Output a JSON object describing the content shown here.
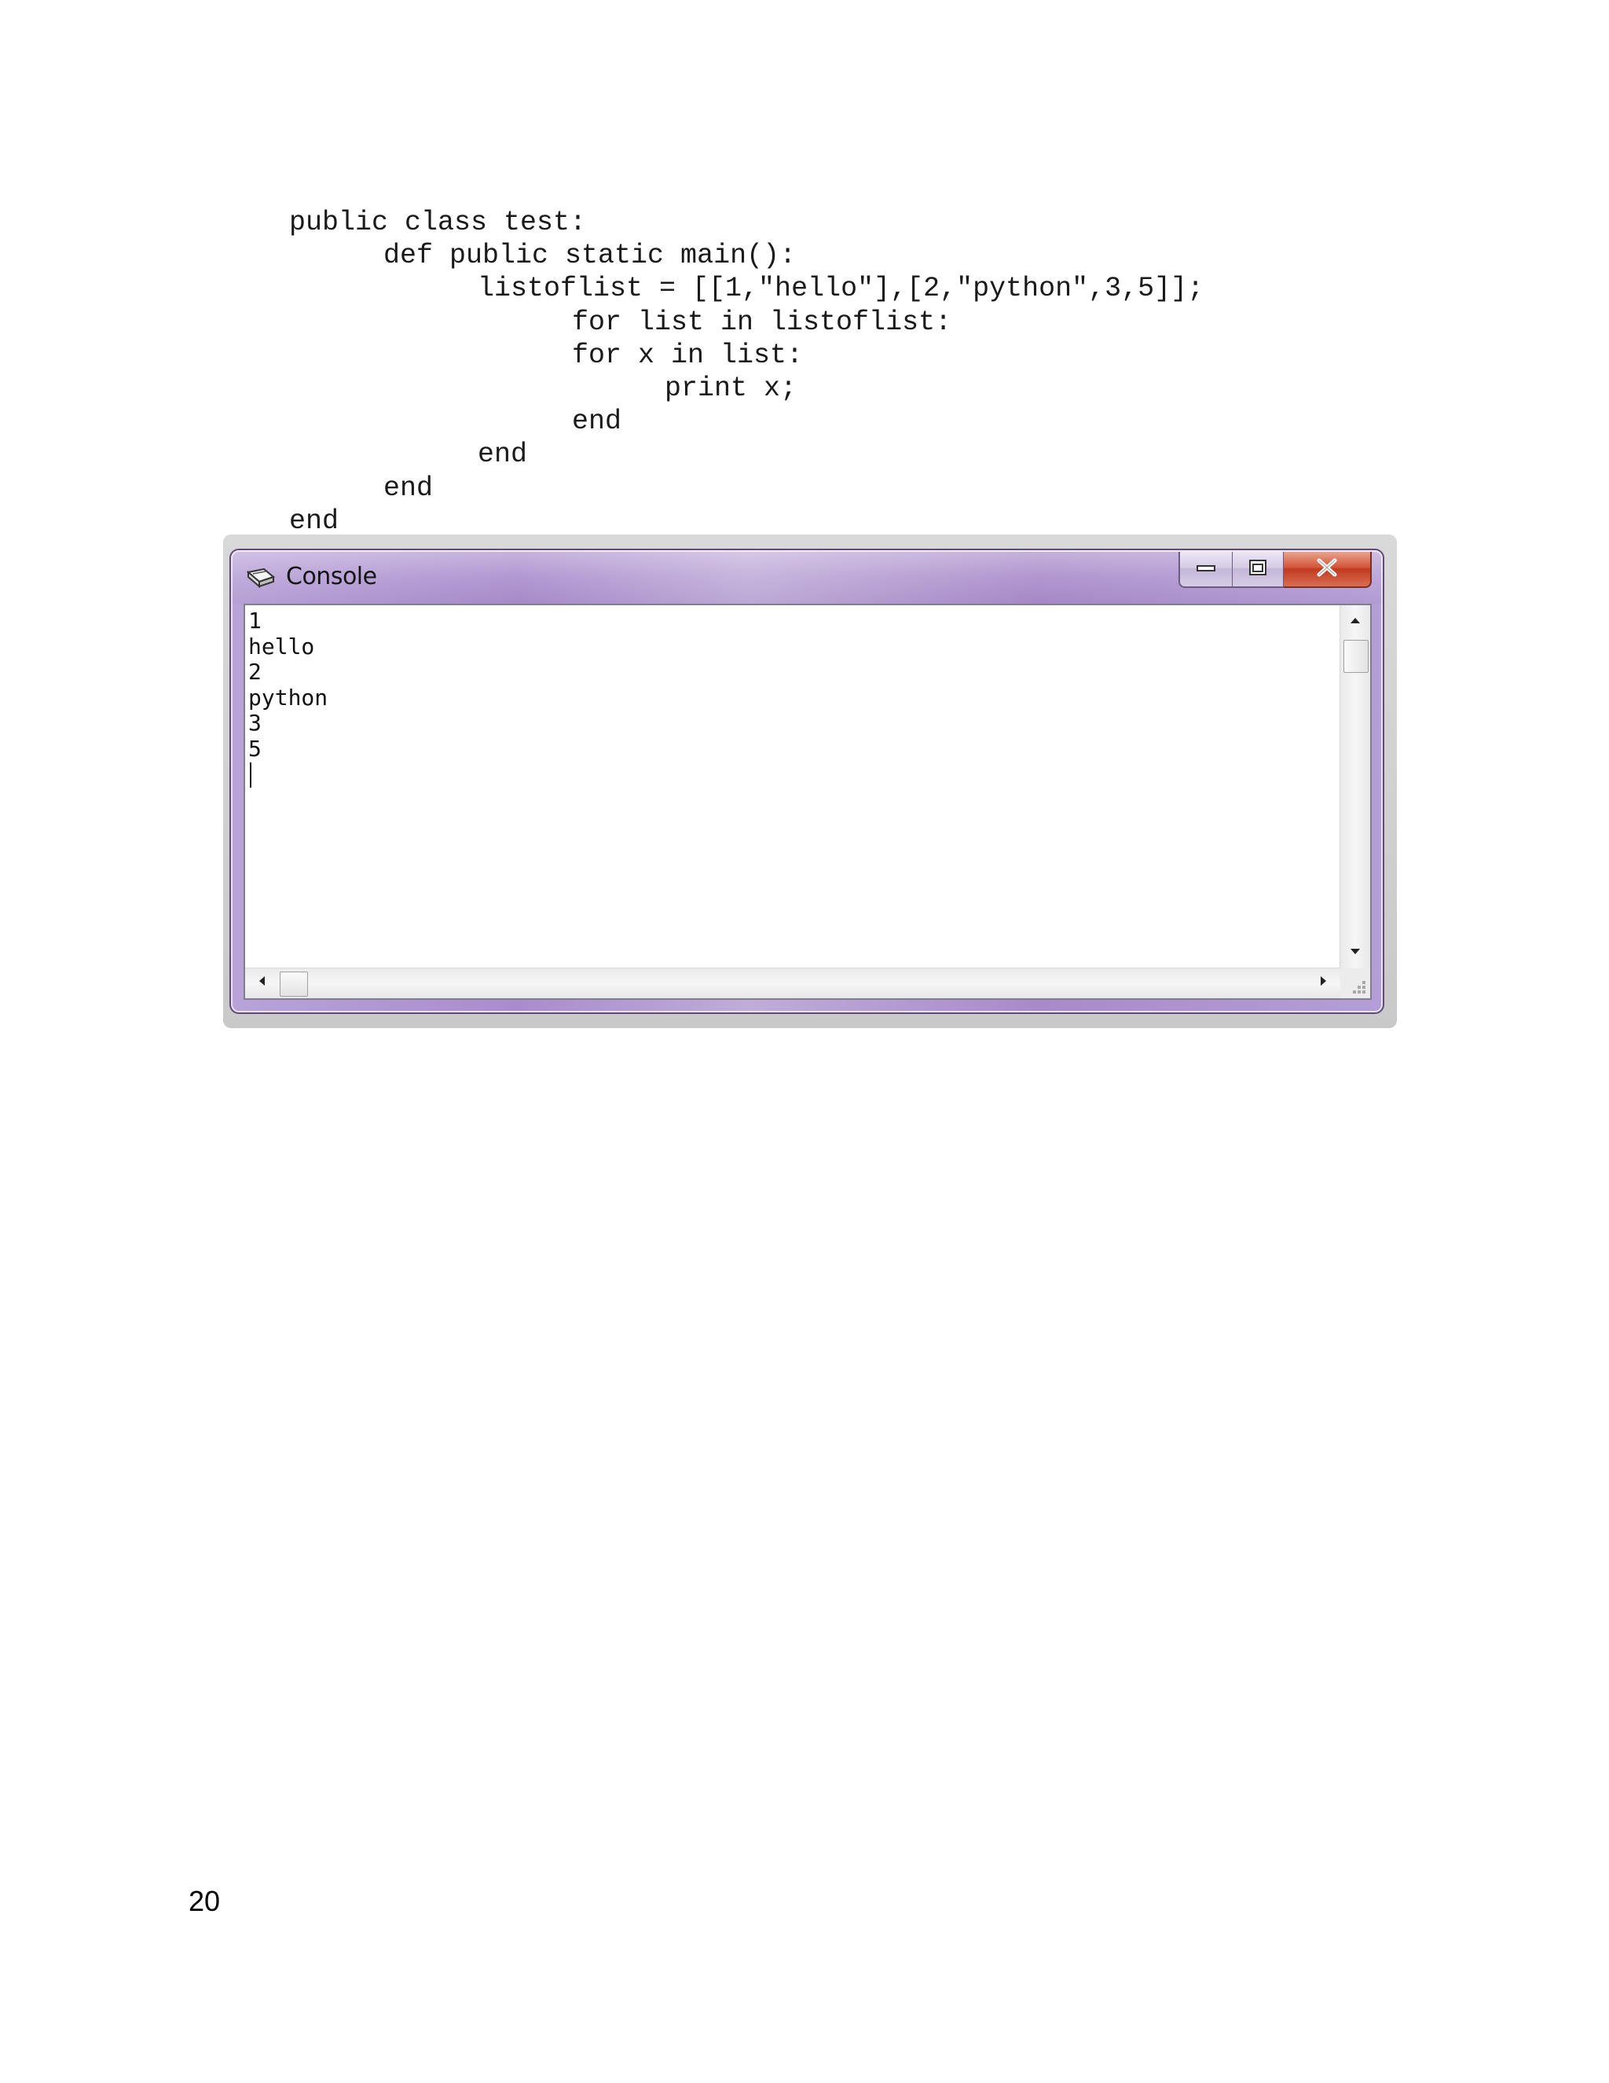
{
  "code_listing": {
    "lines": [
      "public class test:",
      "def public static main():",
      "listoflist = [[1,\"hello\"],[2,\"python\",3,5]];",
      "for list in listoflist:",
      "for x in list:",
      "print x;",
      "end",
      "end",
      "end",
      "end"
    ]
  },
  "console_window": {
    "title": "Console",
    "app_icon": "console-app-icon",
    "controls": {
      "minimize_icon": "minimize-icon",
      "maximize_icon": "maximize-icon",
      "close_icon": "close-icon"
    },
    "output_lines": [
      "1",
      "hello",
      "2",
      "python",
      "3",
      "5"
    ],
    "scrollbars": {
      "up_icon": "arrow-up-icon",
      "down_icon": "arrow-down-icon",
      "left_icon": "arrow-left-icon",
      "right_icon": "arrow-right-icon",
      "grip_icon": "resize-grip-icon"
    }
  },
  "footer": {
    "page_number": "20"
  }
}
